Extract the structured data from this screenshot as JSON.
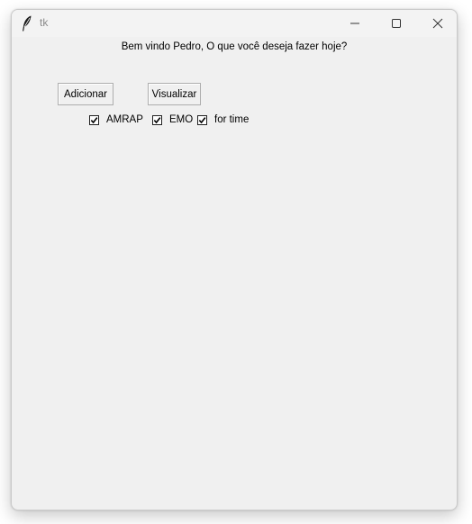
{
  "window": {
    "title": "tk",
    "icon": "feather-icon",
    "controls": [
      "minimize-icon",
      "maximize-icon",
      "close-icon"
    ]
  },
  "main": {
    "greeting": "Bem vindo Pedro, O que você deseja fazer hoje?",
    "buttons": {
      "add": "Adicionar",
      "view": "Visualizar"
    },
    "checkboxes": [
      {
        "label": "AMRAP",
        "checked": true
      },
      {
        "label": "EMO",
        "checked": true
      },
      {
        "label": "for time",
        "checked": true
      }
    ]
  }
}
